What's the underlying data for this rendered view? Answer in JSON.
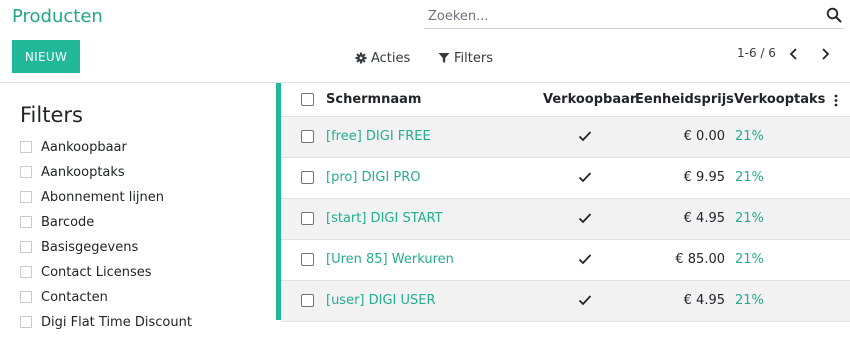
{
  "header": {
    "title": "Producten",
    "search_placeholder": "Zoeken...",
    "new_button": "NIEUW",
    "actions_label": "Acties",
    "filters_label": "Filters",
    "pager": "1-6 / 6"
  },
  "colors": {
    "accent": "#21b799",
    "link": "#24ad8f"
  },
  "icons": {
    "search": "search-icon",
    "actions": "gear-icon",
    "filters": "funnel-icon",
    "prev": "chevron-left-icon",
    "next": "chevron-right-icon",
    "column_options": "kebab-menu-icon",
    "saleable": "check-icon"
  },
  "filter_panel": {
    "heading": "Filters",
    "items": [
      "Aankoopbaar",
      "Aankooptaks",
      "Abonnement lijnen",
      "Barcode",
      "Basisgegevens",
      "Contact Licenses",
      "Contacten",
      "Digi Flat Time Discount"
    ]
  },
  "table": {
    "columns": [
      "Schermnaam",
      "Verkoopbaar",
      "Eenheidsprijs",
      "Verkooptaks"
    ],
    "rows": [
      {
        "name": "[free] DIGI FREE",
        "saleable": true,
        "price": "€ 0.00",
        "tax": "21%"
      },
      {
        "name": "[pro] DIGI PRO",
        "saleable": true,
        "price": "€ 9.95",
        "tax": "21%"
      },
      {
        "name": "[start] DIGI START",
        "saleable": true,
        "price": "€ 4.95",
        "tax": "21%"
      },
      {
        "name": "[Uren 85] Werkuren",
        "saleable": true,
        "price": "€ 85.00",
        "tax": "21%"
      },
      {
        "name": "[user] DIGI USER",
        "saleable": true,
        "price": "€ 4.95",
        "tax": "21%"
      }
    ]
  }
}
